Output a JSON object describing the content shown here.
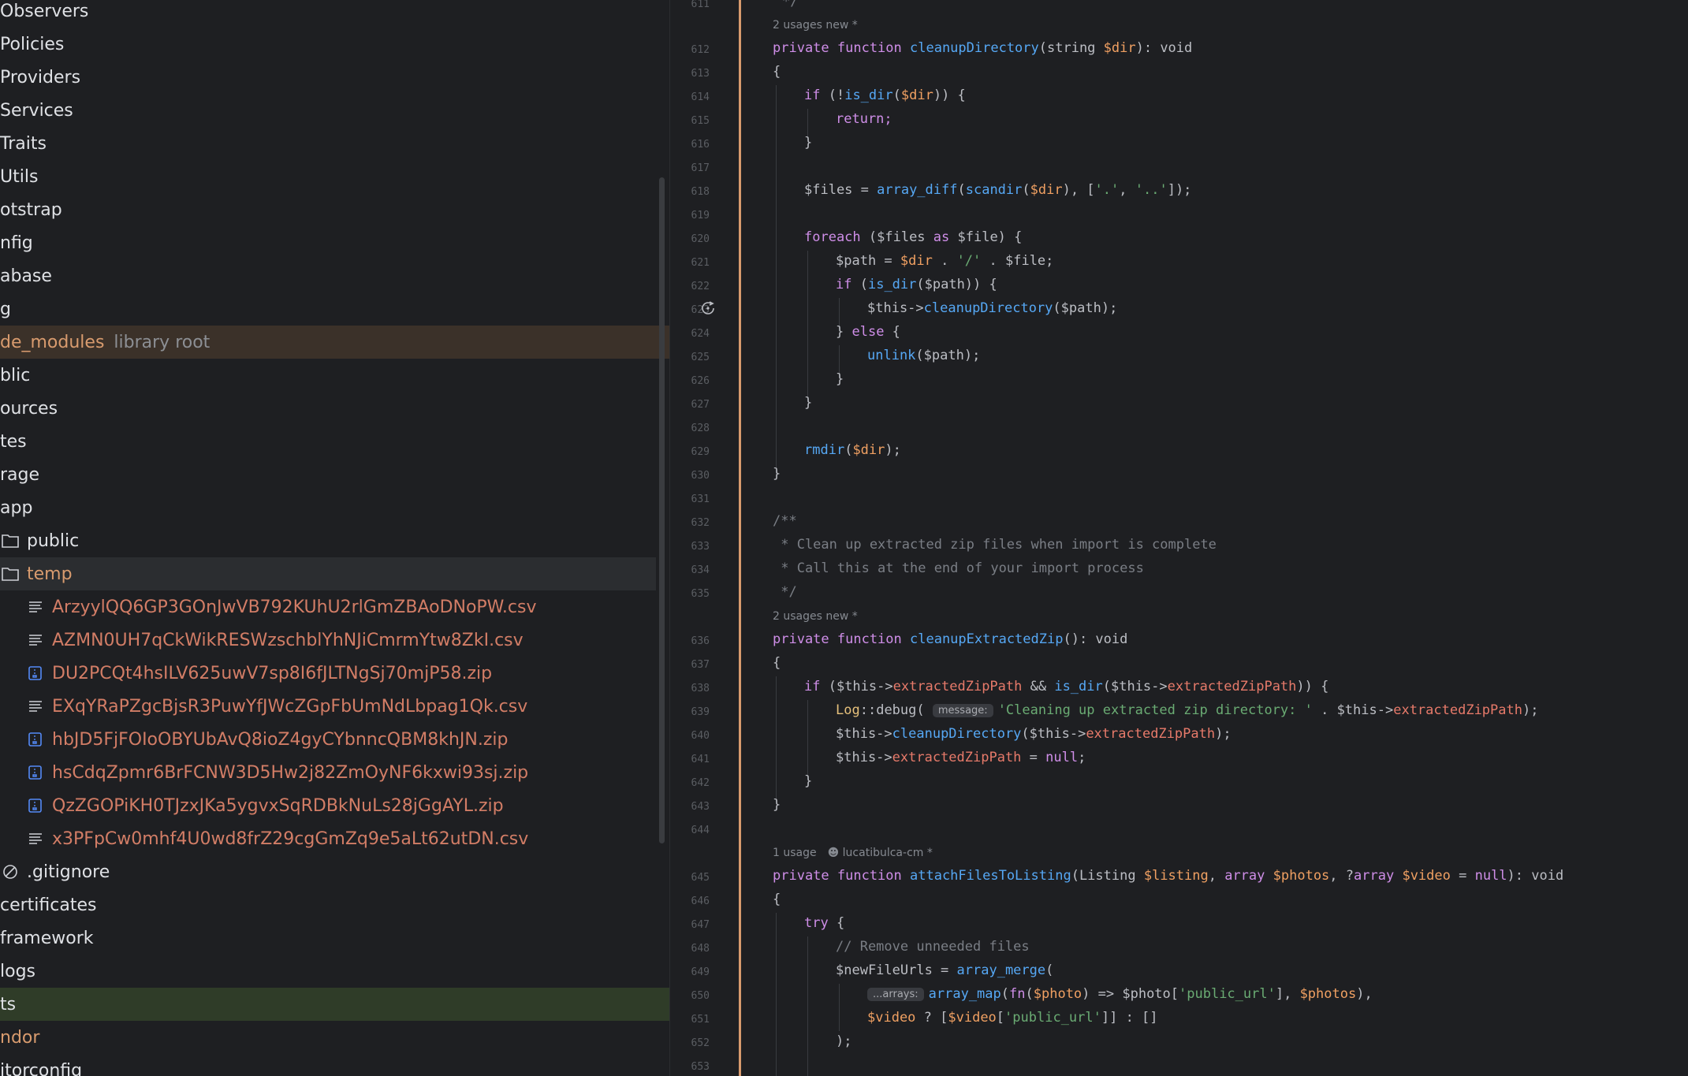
{
  "tree": {
    "items": [
      {
        "label": "Observers",
        "type": "folder-clip"
      },
      {
        "label": "Policies",
        "type": "folder-clip"
      },
      {
        "label": "Providers",
        "type": "folder-clip"
      },
      {
        "label": "Services",
        "type": "folder-clip"
      },
      {
        "label": "Traits",
        "type": "folder-clip"
      },
      {
        "label": "Utils",
        "type": "folder-clip"
      },
      {
        "label": "otstrap",
        "type": "folder-clip"
      },
      {
        "label": "nfig",
        "type": "folder-clip"
      },
      {
        "label": "abase",
        "type": "folder-clip"
      },
      {
        "label": "g",
        "type": "folder-clip"
      },
      {
        "label": "de_modules",
        "suffix": "library root",
        "type": "lib"
      },
      {
        "label": "blic",
        "type": "folder-clip"
      },
      {
        "label": "ources",
        "type": "folder-clip"
      },
      {
        "label": "tes",
        "type": "folder-clip"
      },
      {
        "label": "rage",
        "type": "folder-clip"
      },
      {
        "label": "app",
        "type": "folder-clip"
      },
      {
        "label": "public",
        "type": "folder"
      },
      {
        "label": "temp",
        "type": "folder-selected"
      },
      {
        "label": "ArzyylQQ6GP3GOnJwVB792KUhU2rlGmZBAoDNoPW.csv",
        "type": "csv"
      },
      {
        "label": "AZMN0UH7qCkWikRESWzschblYhNJiCmrmYtw8ZkI.csv",
        "type": "csv"
      },
      {
        "label": "DU2PCQt4hsILV625uwV7sp8I6fJLTNgSj70mjP58.zip",
        "type": "zip"
      },
      {
        "label": "EXqYRaPZgcBjsR3PuwYfJWcZGpFbUmNdLbpag1Qk.csv",
        "type": "csv"
      },
      {
        "label": "hbJD5FjFOIoOBYUbAvQ8ioZ4gyCYbnncQBM8khJN.zip",
        "type": "zip"
      },
      {
        "label": "hsCdqZpmr6BrFCNW3D5Hw2j82ZmOyNF6kxwi93sj.zip",
        "type": "zip"
      },
      {
        "label": "QzZGOPiKH0TJzxJKa5ygvxSqRDBkNuLs28jGgAYL.zip",
        "type": "zip"
      },
      {
        "label": "x3PFpCw0mhf4U0wd8frZ29cgGmZq9e5aLt62utDN.csv",
        "type": "csv"
      },
      {
        "label": ".gitignore",
        "type": "ignore"
      },
      {
        "label": "certificates",
        "type": "folder-clip"
      },
      {
        "label": "framework",
        "type": "folder-clip"
      },
      {
        "label": "logs",
        "type": "folder-clip"
      },
      {
        "label": "ts",
        "type": "green"
      },
      {
        "label": "ndor",
        "type": "orange"
      },
      {
        "label": "itorconfig",
        "type": "folder-clip"
      }
    ]
  },
  "hints": {
    "usages2_new": "2 usages   new *",
    "usage1": "1 usage",
    "author": "lucatibulca-cm *",
    "message_param": "message:",
    "arrays_param": "...arrays:"
  },
  "code": {
    "l611": "*/",
    "l612_a": "private function ",
    "l612_fn": "cleanupDirectory",
    "l612_b": "(string ",
    "l612_v": "$dir",
    "l612_c": "): void",
    "brace_open": "{",
    "brace_close": "}",
    "l614_a": "if (!",
    "l614_fn": "is_dir",
    "l614_b": "(",
    "l614_v": "$dir",
    "l614_c": ")) {",
    "l615": "return;",
    "l618_a": "$files = ",
    "l618_fn1": "array_diff",
    "l618_b": "(",
    "l618_fn2": "scandir",
    "l618_c": "(",
    "l618_v": "$dir",
    "l618_d": "), [",
    "l618_s1": "'.'",
    "l618_e": ", ",
    "l618_s2": "'..'",
    "l618_f": "]);",
    "l620_kw": "foreach",
    "l620_a": " ($files ",
    "l620_as": "as",
    "l620_b": " $file) {",
    "l621_a": "$path = ",
    "l621_v": "$dir",
    "l621_b": " . ",
    "l621_s": "'/'",
    "l621_c": " . $file;",
    "l622_kw": "if",
    "l622_a": " (",
    "l622_fn": "is_dir",
    "l622_b": "($path)) {",
    "l623_a": "$this->",
    "l623_fn": "cleanupDirectory",
    "l623_b": "($path);",
    "l624_a": "} ",
    "l624_kw": "else",
    "l624_b": " {",
    "l625_fn": "unlink",
    "l625_a": "($path);",
    "l629_fn": "rmdir",
    "l629_a": "(",
    "l629_v": "$dir",
    "l629_b": ");",
    "l632": "/**",
    "l633": " * Clean up extracted zip files when import is complete",
    "l634": " * Call this at the end of your import process",
    "l635": " */",
    "l636_fn": "cleanupExtractedZip",
    "l636_b": "(): void",
    "l638_a": "if ($this->",
    "l638_p1": "extractedZipPath",
    "l638_b": " && ",
    "l638_fn": "is_dir",
    "l638_c": "($this->",
    "l638_p2": "extractedZipPath",
    "l638_d": ")) {",
    "l639_cls": "Log",
    "l639_a": "::",
    "l639_fn": "debug",
    "l639_b": "( ",
    "l639_s": "'Cleaning up extracted zip directory: '",
    "l639_c": " . $this->",
    "l639_p": "extractedZipPath",
    "l639_d": ");",
    "l640_b": "($this->",
    "l640_p": "extractedZipPath",
    "l640_c": ");",
    "l641_a": "$this->",
    "l641_p": "extractedZipPath",
    "l641_b": " = ",
    "l641_kw": "null",
    "l641_c": ";",
    "l645_fn": "attachFilesToListing",
    "l645_b": "(Listing ",
    "l645_v1": "$listing",
    "l645_c": ", ",
    "l645_kw1": "array",
    "l645_d": " ",
    "l645_v2": "$photos",
    "l645_e": ", ?",
    "l645_kw2": "array",
    "l645_f": " ",
    "l645_v3": "$video",
    "l645_g": " = ",
    "l645_kw3": "null",
    "l645_h": "): void",
    "l647_kw": "try",
    "l647_a": " {",
    "l648": "// Remove unneeded files",
    "l649_a": "$newFileUrls = ",
    "l649_fn": "array_merge",
    "l649_b": "(",
    "l650_fn": "array_map",
    "l650_a": "(",
    "l650_kw": "fn",
    "l650_b": "(",
    "l650_v": "$photo",
    "l650_c": ") => ",
    "l650_d": "$photo[",
    "l650_s": "'public_url'",
    "l650_e": "], ",
    "l650_v2": "$photos",
    "l650_f": "),",
    "l651_v": "$video",
    "l651_a": " ? [",
    "l651_v2": "$video",
    "l651_b": "[",
    "l651_s": "'public_url'",
    "l651_c": "]] : []",
    "l652": ");"
  },
  "line_numbers": [
    "611",
    "612",
    "613",
    "614",
    "615",
    "616",
    "617",
    "618",
    "619",
    "620",
    "621",
    "622",
    "623",
    "624",
    "625",
    "626",
    "627",
    "628",
    "629",
    "630",
    "631",
    "632",
    "633",
    "634",
    "635",
    "636",
    "637",
    "638",
    "639",
    "640",
    "641",
    "642",
    "643",
    "644",
    "645",
    "646",
    "647",
    "648",
    "649",
    "650",
    "651",
    "652",
    "653"
  ],
  "colors": {
    "background": "#1e1f22",
    "selection": "#2b2d30",
    "gutter_marker": "#d89b6e",
    "file_red": "#d27d66",
    "keyword": "#cf8ee8",
    "function": "#56a8f5",
    "string": "#6aab73"
  }
}
